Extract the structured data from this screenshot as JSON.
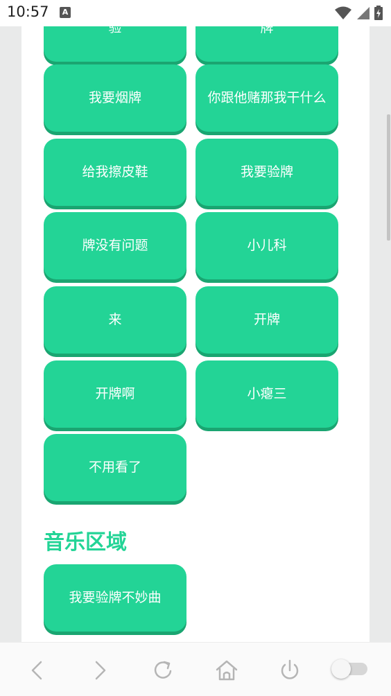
{
  "status_bar": {
    "time": "10:57",
    "notification_icon_letter": "A",
    "icons": [
      "wifi-icon",
      "signal-icon",
      "battery-charging-icon"
    ]
  },
  "buttons": [
    {
      "label": "验"
    },
    {
      "label": "牌"
    },
    {
      "label": "我要烟牌"
    },
    {
      "label": "你跟他赌那我干什么"
    },
    {
      "label": "给我擦皮鞋"
    },
    {
      "label": "我要验牌"
    },
    {
      "label": "牌没有问题"
    },
    {
      "label": "小儿科"
    },
    {
      "label": "来"
    },
    {
      "label": "开牌"
    },
    {
      "label": "开牌啊"
    },
    {
      "label": "小瘪三"
    },
    {
      "label": "不用看了"
    }
  ],
  "music_section": {
    "title": "音乐区域",
    "buttons": [
      {
        "label": "我要验牌不妙曲"
      }
    ]
  },
  "bottom_nav": {
    "items": [
      "back-icon",
      "forward-icon",
      "refresh-icon",
      "home-icon",
      "power-icon",
      "toggle-switch"
    ]
  },
  "colors": {
    "accent": "#23d496",
    "accent_shadow": "#1aa571",
    "background": "#e9eaea"
  }
}
